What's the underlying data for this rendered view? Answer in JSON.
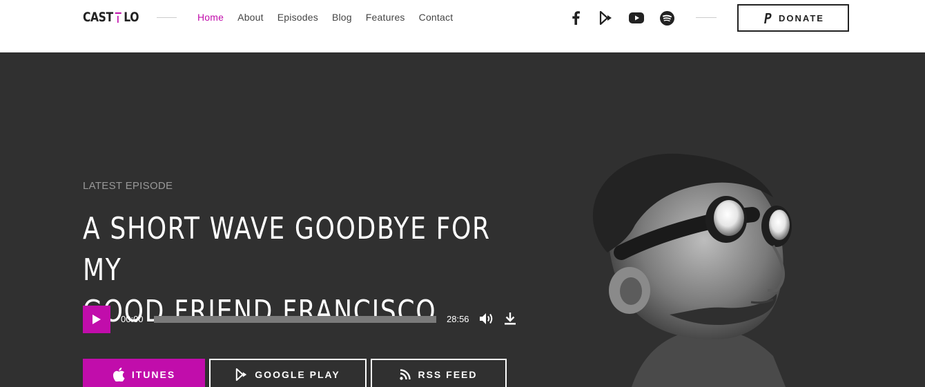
{
  "header": {
    "logo_left": "CAST",
    "logo_right": "LO",
    "nav": [
      {
        "label": "Home",
        "active": true
      },
      {
        "label": "About",
        "active": false
      },
      {
        "label": "Episodes",
        "active": false
      },
      {
        "label": "Blog",
        "active": false
      },
      {
        "label": "Features",
        "active": false
      },
      {
        "label": "Contact",
        "active": false
      }
    ],
    "social_icons": [
      "facebook-icon",
      "google-play-icon",
      "youtube-icon",
      "spotify-icon"
    ],
    "donate_label": "DONATE"
  },
  "hero": {
    "eyebrow": "LATEST EPISODE",
    "title_line1": "A SHORT WAVE GOODBYE FOR MY",
    "title_line2": "GOOD FRIEND FRANCISCO",
    "player": {
      "current_time": "00:00",
      "duration": "28:56",
      "progress": 0
    },
    "buttons": {
      "itunes": "ITUNES",
      "google_play": "GOOGLE PLAY",
      "rss": "RSS FEED"
    }
  },
  "colors": {
    "accent": "#c10dab",
    "hero_bg": "#303030"
  }
}
